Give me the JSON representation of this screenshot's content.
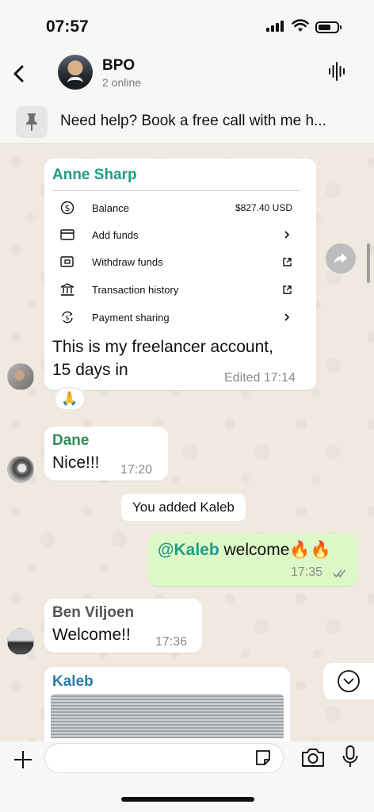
{
  "status_bar": {
    "time": "07:57"
  },
  "header": {
    "title": "BPO",
    "subtitle": "2 online"
  },
  "pinned": {
    "text": "Need help? Book a free call with me h..."
  },
  "messages": {
    "anne": {
      "sender": "Anne Sharp",
      "card": {
        "rows": [
          {
            "label": "Balance",
            "value": "$827.40 USD",
            "icon": "dollar-circle-icon"
          },
          {
            "label": "Add funds",
            "icon": "card-icon",
            "action": "chevron-right-icon"
          },
          {
            "label": "Withdraw funds",
            "icon": "wallet-icon",
            "action": "external-link-icon"
          },
          {
            "label": "Transaction history",
            "icon": "bank-icon",
            "action": "external-link-icon"
          },
          {
            "label": "Payment sharing",
            "icon": "sync-dollar-icon",
            "action": "chevron-right-icon"
          }
        ]
      },
      "text_line1": "This is my freelancer account,",
      "text_line2": "15 days in",
      "meta": "Edited 17:14",
      "reaction": "🙏"
    },
    "dane": {
      "sender": "Dane",
      "text": "Nice!!!",
      "time": "17:20"
    },
    "system": {
      "text": "You added Kaleb"
    },
    "own": {
      "mention": "@Kaleb",
      "text": " welcome🔥🔥",
      "time": "17:35"
    },
    "ben": {
      "sender": "Ben Viljoen",
      "text": "Welcome!!",
      "time": "17:36"
    },
    "kaleb": {
      "sender": "Kaleb"
    }
  },
  "colors": {
    "anne_name": "#1f9e86",
    "dane_name": "#2e8b57",
    "ben_name": "#555555",
    "kaleb_name": "#2a7fa8",
    "mention": "#1f9e86",
    "outgoing_bubble": "#dcf8c6"
  },
  "input": {
    "placeholder": ""
  }
}
